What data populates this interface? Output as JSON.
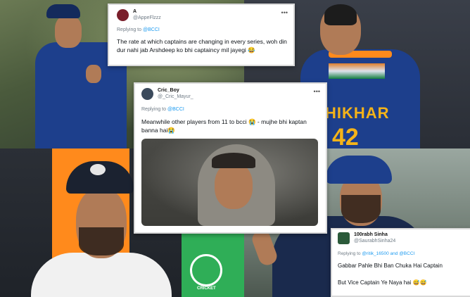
{
  "background_labels": {
    "jersey_name": "HIKHAR",
    "jersey_number": "42",
    "cricket_logo_text": "CRICKET"
  },
  "tweets": [
    {
      "display_name": "A",
      "handle": "@AppeFlzzz",
      "replying_label": "Replying to",
      "replying_to": "@BCCI",
      "text": "The rate at which captains are changing in every series, woh din dur nahi jab Arshdeep ko bhi captaincy mil jayegi 😂",
      "more_icon": "more-horizontal-icon"
    },
    {
      "display_name": "Cric_Boy",
      "handle": "@_Cric_Mayur_",
      "replying_label": "Replying to",
      "replying_to": "@BCCI",
      "text": "Meanwhile other players from 11 to bcci 😭 - mujhe bhi kaptan banna hai😭",
      "more_icon": "more-horizontal-icon"
    },
    {
      "display_name": "100rabh Sinha",
      "handle": "@SaurabhSinha24",
      "replying_label": "Replying to",
      "replying_to": "@ritik_16500 and @BCCI",
      "text_line1": "Gabbar Pahle Bhi Ban Chuka Hai Captain",
      "text_line2": "But Vice Captain Ye Naya hai 😅😅"
    }
  ],
  "colors": {
    "twitter_link": "#1d9bf0",
    "team_blue": "#1d3f8c",
    "team_orange": "#ff8a1c"
  }
}
